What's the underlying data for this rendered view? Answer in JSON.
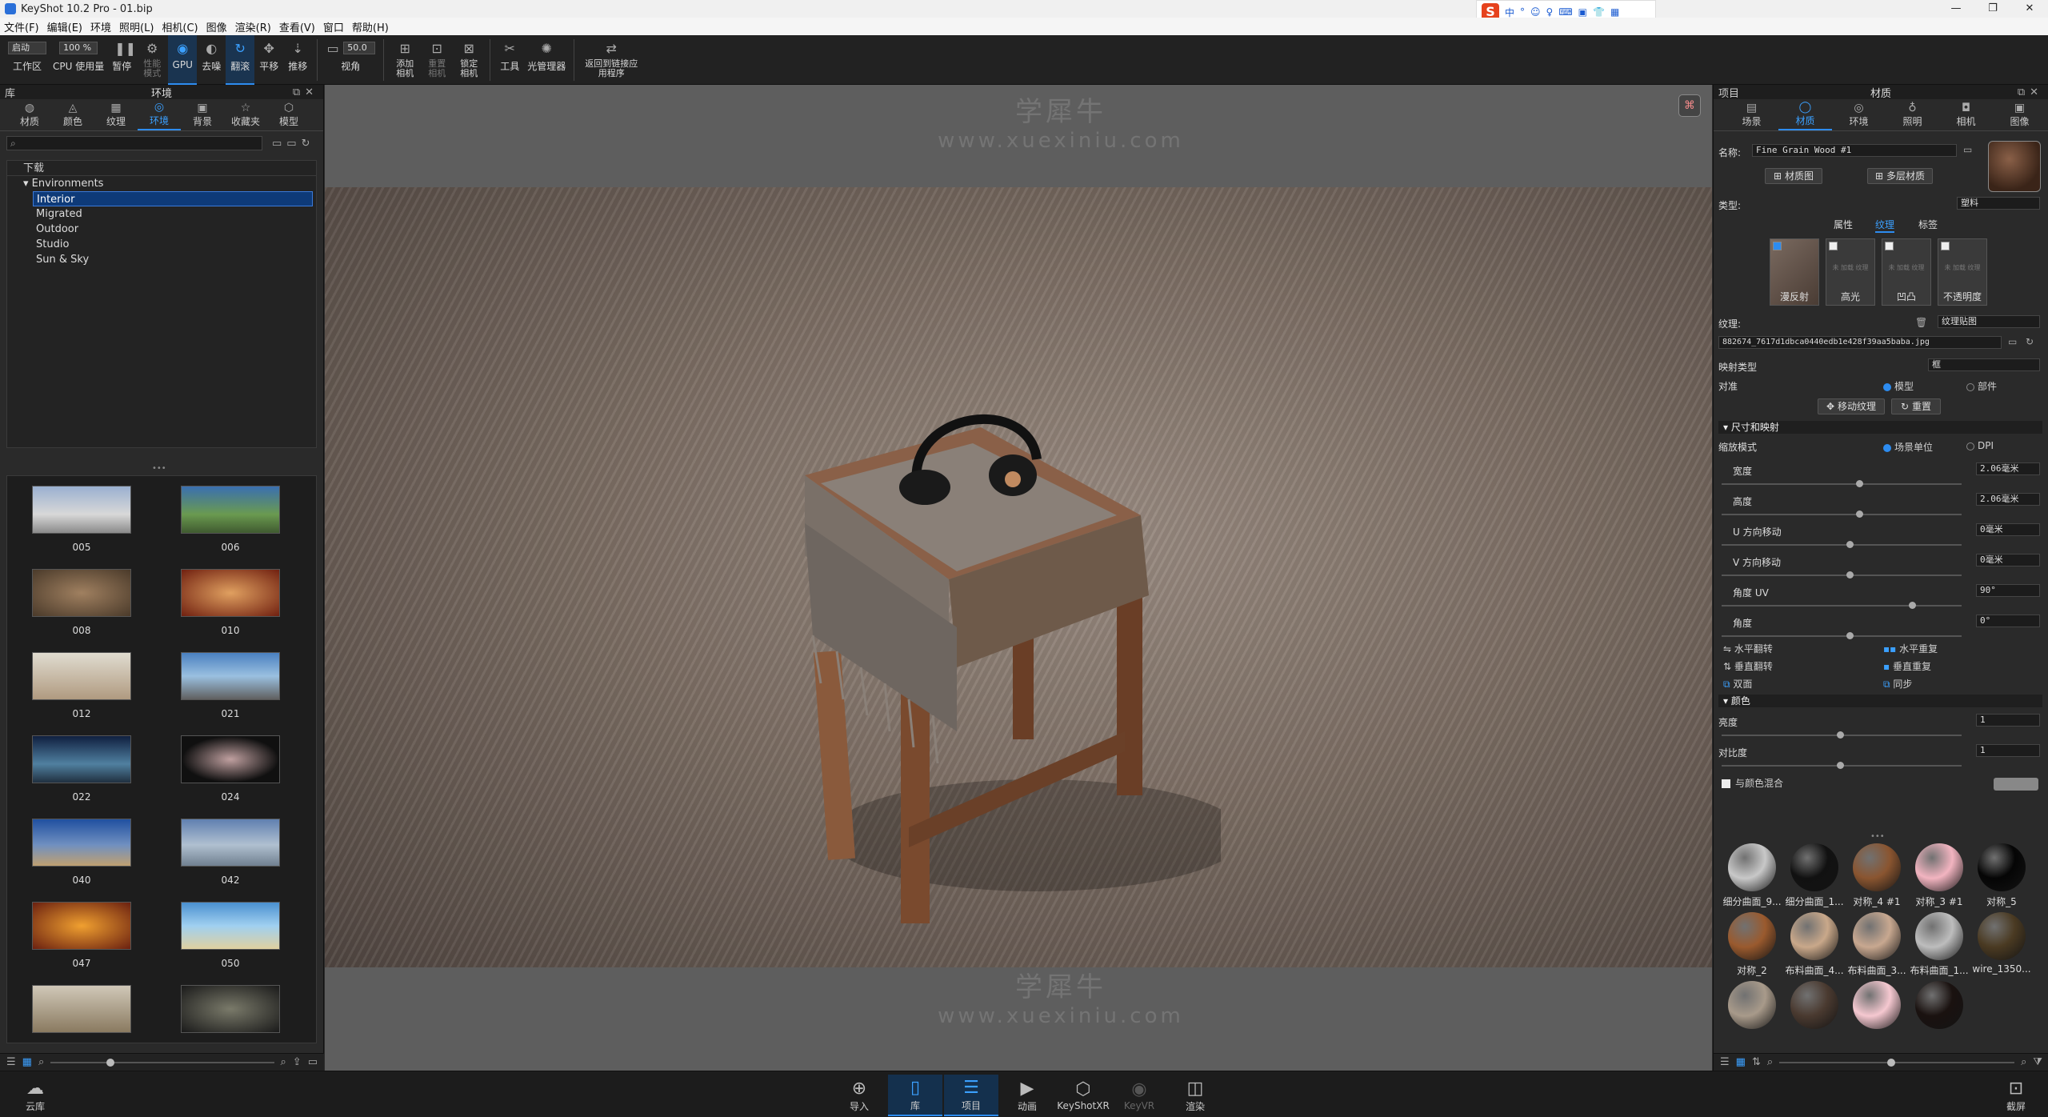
{
  "window": {
    "title": "KeyShot 10.2 Pro  -  01.bip",
    "controls": [
      "—",
      "❐",
      "✕"
    ]
  },
  "ime": {
    "items": [
      "中",
      "°",
      "☺",
      "♀",
      "⌨",
      "▣",
      "👕",
      "▦"
    ]
  },
  "menu": [
    "文件(F)",
    "编辑(E)",
    "环境",
    "照明(L)",
    "相机(C)",
    "图像",
    "渲染(R)",
    "查看(V)",
    "窗口",
    "帮助(H)"
  ],
  "toolbar": {
    "workspace_value": "启动",
    "zoom_value": "100 %",
    "fov_value": "50.0",
    "items": [
      {
        "label": "工作区",
        "icon": "workspace-icon"
      },
      {
        "label": "CPU 使用量",
        "icon": "cpu-icon"
      },
      {
        "label": "暂停",
        "icon": "pause-icon"
      },
      {
        "label": "性能模式",
        "icon": "performance-icon"
      },
      {
        "label": "GPU",
        "icon": "gpu-icon"
      },
      {
        "label": "去噪",
        "icon": "denoise-icon"
      },
      {
        "label": "翻滚",
        "icon": "tumble-icon"
      },
      {
        "label": "平移",
        "icon": "pan-icon"
      },
      {
        "label": "推移",
        "icon": "dolly-icon"
      },
      {
        "label": "视角",
        "icon": "fov-icon"
      },
      {
        "label": "添加相机",
        "icon": "add-camera-icon"
      },
      {
        "label": "重置相机",
        "icon": "reset-camera-icon"
      },
      {
        "label": "锁定相机",
        "icon": "lock-camera-icon"
      },
      {
        "label": "工具",
        "icon": "tools-icon"
      },
      {
        "label": "光管理器",
        "icon": "light-manager-icon"
      },
      {
        "label": "返回到链接应用程序",
        "icon": "return-link-icon"
      }
    ]
  },
  "library": {
    "header_left": "库",
    "header_title": "环境",
    "tabs": [
      {
        "label": "材质",
        "icon": "material-icon"
      },
      {
        "label": "颜色",
        "icon": "color-icon"
      },
      {
        "label": "纹理",
        "icon": "texture-icon"
      },
      {
        "label": "环境",
        "icon": "environment-icon"
      },
      {
        "label": "背景",
        "icon": "background-icon"
      },
      {
        "label": "收藏夹",
        "icon": "favorites-icon"
      },
      {
        "label": "模型",
        "icon": "model-icon"
      }
    ],
    "search_placeholder": "",
    "tree_header": "下载",
    "tree_root": "Environments",
    "tree_items": [
      "Interior",
      "Migrated",
      "Outdoor",
      "Studio",
      "Sun & Sky"
    ],
    "selected": "Interior",
    "thumbnails": [
      "005",
      "006",
      "008",
      "010",
      "012",
      "021",
      "022",
      "024",
      "040",
      "042",
      "047",
      "050",
      "",
      ""
    ]
  },
  "viewport": {
    "watermark": "学犀牛",
    "watermark_url": "www.xuexiniu.com"
  },
  "project": {
    "header_left": "项目",
    "header_title": "材质",
    "tabs": [
      {
        "label": "场景",
        "icon": "scene-icon"
      },
      {
        "label": "材质",
        "icon": "material-icon"
      },
      {
        "label": "环境",
        "icon": "environment-icon"
      },
      {
        "label": "照明",
        "icon": "lighting-icon"
      },
      {
        "label": "相机",
        "icon": "camera-icon"
      },
      {
        "label": "图像",
        "icon": "image-icon"
      }
    ],
    "name_label": "名称:",
    "name_value": "Fine Grain Wood #1",
    "material_graph_btn": "材质图",
    "multi_material_btn": "多层材质",
    "type_label": "类型:",
    "type_value": "塑料",
    "subtabs": [
      "属性",
      "纹理",
      "标签"
    ],
    "slots": [
      {
        "label": "漫反射",
        "checked": true
      },
      {
        "label": "高光",
        "checked": false
      },
      {
        "label": "凹凸",
        "checked": false
      },
      {
        "label": "不透明度",
        "checked": false
      }
    ],
    "slot_empty_text": "未 加载 纹理",
    "texture_label": "纹理:",
    "texture_type": "纹理贴图",
    "texture_file": "882674_7617d1dbca0440edb1e428f39aa5baba.jpg",
    "mapping_label": "映射类型",
    "mapping_value": "框",
    "align_label": "对准",
    "align_options": [
      "模型",
      "部件"
    ],
    "move_texture_btn": "移动纹理",
    "reset_btn": "重置",
    "size_section": "尺寸和映射",
    "scale_mode_label": "缩放模式",
    "scale_mode_options": [
      "场景单位",
      "DPI"
    ],
    "params": [
      {
        "label": "宽度",
        "value": "2.06毫米",
        "pos": 0.56
      },
      {
        "label": "高度",
        "value": "2.06毫米",
        "pos": 0.56
      },
      {
        "label": "U 方向移动",
        "value": "0毫米",
        "pos": 0.52
      },
      {
        "label": "V 方向移动",
        "value": "0毫米",
        "pos": 0.52
      },
      {
        "label": "角度 UV",
        "value": "90°",
        "pos": 0.78
      },
      {
        "label": "角度",
        "value": "0°",
        "pos": 0.52
      }
    ],
    "flips_left": [
      "水平翻转",
      "垂直翻转",
      "双面"
    ],
    "flips_right": [
      "水平重复",
      "垂直重复",
      "同步"
    ],
    "color_section": "颜色",
    "brightness_label": "亮度",
    "brightness_value": "1",
    "contrast_label": "对比度",
    "contrast_value": "1",
    "blend_label": "与颜色混合",
    "materials": [
      {
        "name": "细分曲面_9...",
        "color": "#c8c8c8"
      },
      {
        "name": "细分曲面_1...",
        "color": "#111111"
      },
      {
        "name": "对称_4 #1",
        "color": "#8a5530"
      },
      {
        "name": "对称_3 #1",
        "color": "#f2b4c0"
      },
      {
        "name": "对称_5",
        "color": "#050505"
      },
      {
        "name": "对称_2",
        "color": "#9a5a2e"
      },
      {
        "name": "布料曲面_4...",
        "color": "#c9a88a"
      },
      {
        "name": "布料曲面_3...",
        "color": "#c8a890"
      },
      {
        "name": "布料曲面_1...",
        "color": "#bdbdbd"
      },
      {
        "name": "wire_1350...",
        "color": "#4a3a22"
      },
      {
        "name": "",
        "color": "#a89a8a"
      },
      {
        "name": "",
        "color": "#4a3a30"
      },
      {
        "name": "",
        "color": "#f5c8d0"
      },
      {
        "name": "",
        "color": "#1a1210"
      }
    ]
  },
  "bottombar": {
    "cloud": "云库",
    "items": [
      {
        "label": "导入",
        "icon": "import-icon"
      },
      {
        "label": "库",
        "icon": "library-icon"
      },
      {
        "label": "项目",
        "icon": "project-icon"
      },
      {
        "label": "动画",
        "icon": "animation-icon"
      },
      {
        "label": "KeyShotXR",
        "icon": "keyshotxr-icon"
      },
      {
        "label": "KeyVR",
        "icon": "keyvr-icon"
      },
      {
        "label": "渲染",
        "icon": "render-icon"
      }
    ],
    "screenshot": "截屏"
  }
}
